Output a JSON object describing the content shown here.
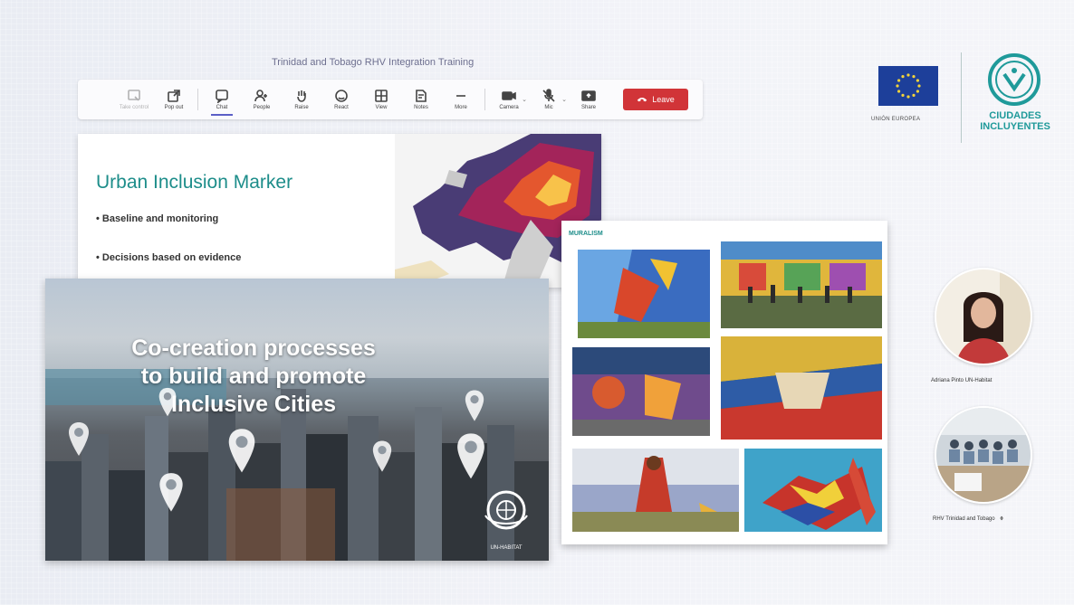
{
  "meeting": {
    "title": "Trinidad and Tobago RHV Integration Training"
  },
  "toolbar": {
    "buttons": [
      {
        "label": "Take control",
        "icon": "take-control-icon",
        "disabled": true
      },
      {
        "label": "Pop out",
        "icon": "pop-out-icon"
      },
      {
        "label": "Chat",
        "icon": "chat-icon",
        "active": true
      },
      {
        "label": "People",
        "icon": "people-icon"
      },
      {
        "label": "Raise",
        "icon": "raise-hand-icon"
      },
      {
        "label": "React",
        "icon": "react-icon"
      },
      {
        "label": "View",
        "icon": "view-icon"
      },
      {
        "label": "Notes",
        "icon": "notes-icon"
      },
      {
        "label": "More",
        "icon": "more-icon"
      },
      {
        "label": "Camera",
        "icon": "camera-icon"
      },
      {
        "label": "Mic",
        "icon": "mic-icon"
      },
      {
        "label": "Share",
        "icon": "share-icon"
      }
    ],
    "leave_label": "Leave",
    "leave_color": "#d13438"
  },
  "partners": {
    "eu_caption": "UNIÓN EUROPEA",
    "ci_line1": "CIUDADES",
    "ci_line2": "INCLUYENTES",
    "accent": "#1f9a9a"
  },
  "slide1": {
    "title": "Urban Inclusion Marker",
    "bullets": [
      "• Baseline and monitoring",
      "• Decisions based on evidence"
    ],
    "accent": "#1d8d8a"
  },
  "slide2": {
    "headline_lines": [
      "Co-creation processes",
      "to build and promote",
      "Inclusive Cities"
    ],
    "logo_caption": "UN-HABITAT"
  },
  "slide3": {
    "section_title": "MURALISM"
  },
  "participants": [
    {
      "name": "Adriana Pinto UN-Habitat"
    },
    {
      "name": "RHV Trinidad and Tobago",
      "mic_icon": "mic-muted-icon"
    }
  ]
}
